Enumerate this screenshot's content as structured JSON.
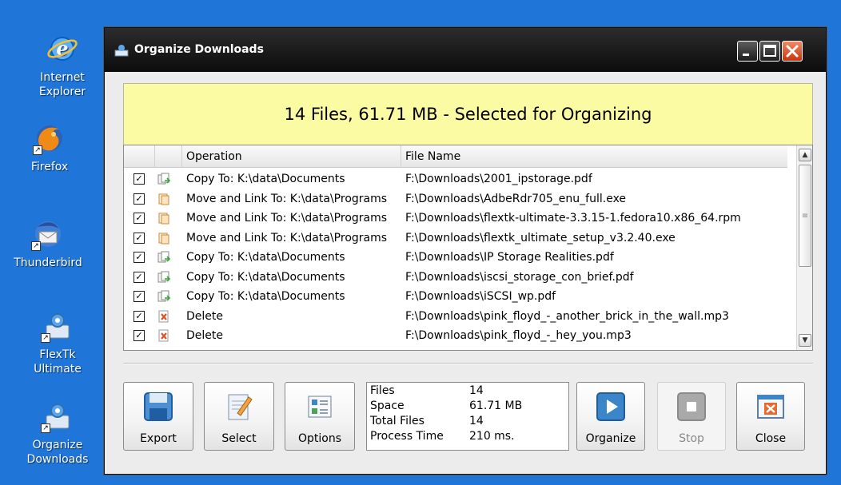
{
  "desktop": {
    "icons": [
      {
        "label_line1": "Internet",
        "label_line2": "Explorer",
        "icon": "internet-explorer-icon"
      },
      {
        "label_line1": "Firefox",
        "label_line2": "",
        "icon": "firefox-icon"
      },
      {
        "label_line1": "Thunderbird",
        "label_line2": "",
        "icon": "thunderbird-icon"
      },
      {
        "label_line1": "FlexTk",
        "label_line2": "Ultimate",
        "icon": "flextk-ultimate-icon"
      },
      {
        "label_line1": "Organize",
        "label_line2": "Downloads",
        "icon": "organize-downloads-icon"
      }
    ]
  },
  "window": {
    "title": "Organize Downloads",
    "banner": "14 Files, 61.71 MB - Selected for Organizing",
    "columns": {
      "operation": "Operation",
      "file_name": "File Name"
    },
    "rows": [
      {
        "checked": true,
        "kind": "copy",
        "operation": "Copy To: K:\\data\\Documents",
        "file": "F:\\Downloads\\2001_ipstorage.pdf"
      },
      {
        "checked": true,
        "kind": "move",
        "operation": "Move and Link To: K:\\data\\Programs",
        "file": "F:\\Downloads\\AdbeRdr705_enu_full.exe"
      },
      {
        "checked": true,
        "kind": "move",
        "operation": "Move and Link To: K:\\data\\Programs",
        "file": "F:\\Downloads\\flextk-ultimate-3.3.15-1.fedora10.x86_64.rpm"
      },
      {
        "checked": true,
        "kind": "move",
        "operation": "Move and Link To: K:\\data\\Programs",
        "file": "F:\\Downloads\\flextk_ultimate_setup_v3.2.40.exe"
      },
      {
        "checked": true,
        "kind": "copy",
        "operation": "Copy To: K:\\data\\Documents",
        "file": "F:\\Downloads\\IP Storage Realities.pdf"
      },
      {
        "checked": true,
        "kind": "copy",
        "operation": "Copy To: K:\\data\\Documents",
        "file": "F:\\Downloads\\iscsi_storage_con_brief.pdf"
      },
      {
        "checked": true,
        "kind": "copy",
        "operation": "Copy To: K:\\data\\Documents",
        "file": "F:\\Downloads\\iSCSI_wp.pdf"
      },
      {
        "checked": true,
        "kind": "delete",
        "operation": "Delete",
        "file": "F:\\Downloads\\pink_floyd_-_another_brick_in_the_wall.mp3"
      },
      {
        "checked": true,
        "kind": "delete",
        "operation": "Delete",
        "file": "F:\\Downloads\\pink_floyd_-_hey_you.mp3"
      }
    ],
    "toolbar": {
      "export": "Export",
      "select": "Select",
      "options": "Options",
      "organize": "Organize",
      "stop": "Stop",
      "close": "Close"
    },
    "stats": [
      {
        "label": "Files",
        "value": "14"
      },
      {
        "label": "Space",
        "value": "61.71 MB"
      },
      {
        "label": "Total Files",
        "value": "14"
      },
      {
        "label": "Process Time",
        "value": "210 ms."
      }
    ]
  },
  "colors": {
    "desktop": "#1f76d8",
    "banner": "#fbfba4",
    "close_button": "#d9441a",
    "organize_icon": "#3a86c8"
  }
}
